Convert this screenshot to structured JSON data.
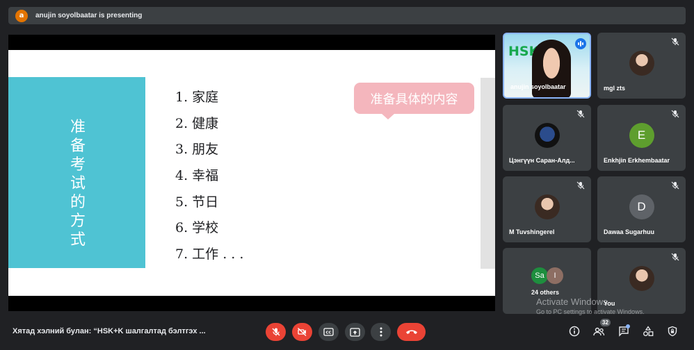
{
  "presenting": {
    "avatar_letter": "a",
    "text": "anujin soyolbaatar is presenting"
  },
  "slide": {
    "vertical_text": "准备考试的方式",
    "items": [
      "1. 家庭",
      "2. 健康",
      "3. 朋友",
      "4. 幸福",
      "5. 节日",
      "6. 学校",
      "7. 工作  . . ."
    ],
    "callout": "准备具体的内容",
    "colors": {
      "band": "#4fc3d3",
      "callout": "#f4b6bd"
    }
  },
  "participants": [
    {
      "name": "anujin soyolbaatar",
      "logo": "HSK",
      "speaking": true
    },
    {
      "name": "mgl zts",
      "muted": true
    },
    {
      "name": "Цэнгүүн Саран-Алд...",
      "muted": true
    },
    {
      "name": "Enkhjin Erkhembaatar",
      "initial": "E",
      "color": "#5e9e2e",
      "muted": true
    },
    {
      "name": "M Tuvshingerel",
      "muted": true
    },
    {
      "name": "Dawaa Sugarhuu",
      "initial": "D",
      "color": "#5f6368",
      "muted": true
    },
    {
      "name": "24 others",
      "initials": [
        "Sa",
        "I"
      ]
    },
    {
      "name": "You",
      "muted": true
    }
  ],
  "watermark": {
    "title": "Activate Windows",
    "subtitle": "Go to PC settings to activate Windows."
  },
  "bottom": {
    "meeting_title": "Хятад хэлний булан: “HSK+K шалгалтад бэлтгэх ...",
    "participant_count": "32"
  },
  "colors": {
    "accent": "#8ab4f8",
    "danger": "#ea4335",
    "surface": "#3c4043",
    "background": "#202124"
  }
}
